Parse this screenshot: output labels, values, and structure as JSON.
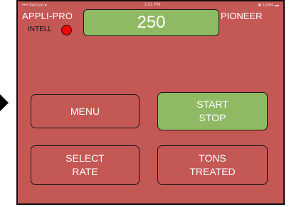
{
  "statusbar": {
    "carrier": "•••• Verizon ▾",
    "time": "2:31 PM",
    "battery": "✱ 100% ▬"
  },
  "header": {
    "brand_left": "APPLI-PRO",
    "brand_right": "PIONEER",
    "indicator_label": "INTELL",
    "counter_value": "250"
  },
  "buttons": {
    "menu": {
      "line1": "MENU"
    },
    "start_stop": {
      "line1": "START",
      "line2": "STOP"
    },
    "select_rate": {
      "line1": "SELECT",
      "line2": "RATE"
    },
    "tons_treated": {
      "line1": "TONS",
      "line2": "TREATED"
    }
  },
  "colors": {
    "background": "#c45855",
    "accent_green": "#8fba63",
    "indicator_red": "#ff0000",
    "text": "#ffffff"
  },
  "icons": {
    "pointer": "arrow-right-icon",
    "indicator": "status-led-icon"
  }
}
